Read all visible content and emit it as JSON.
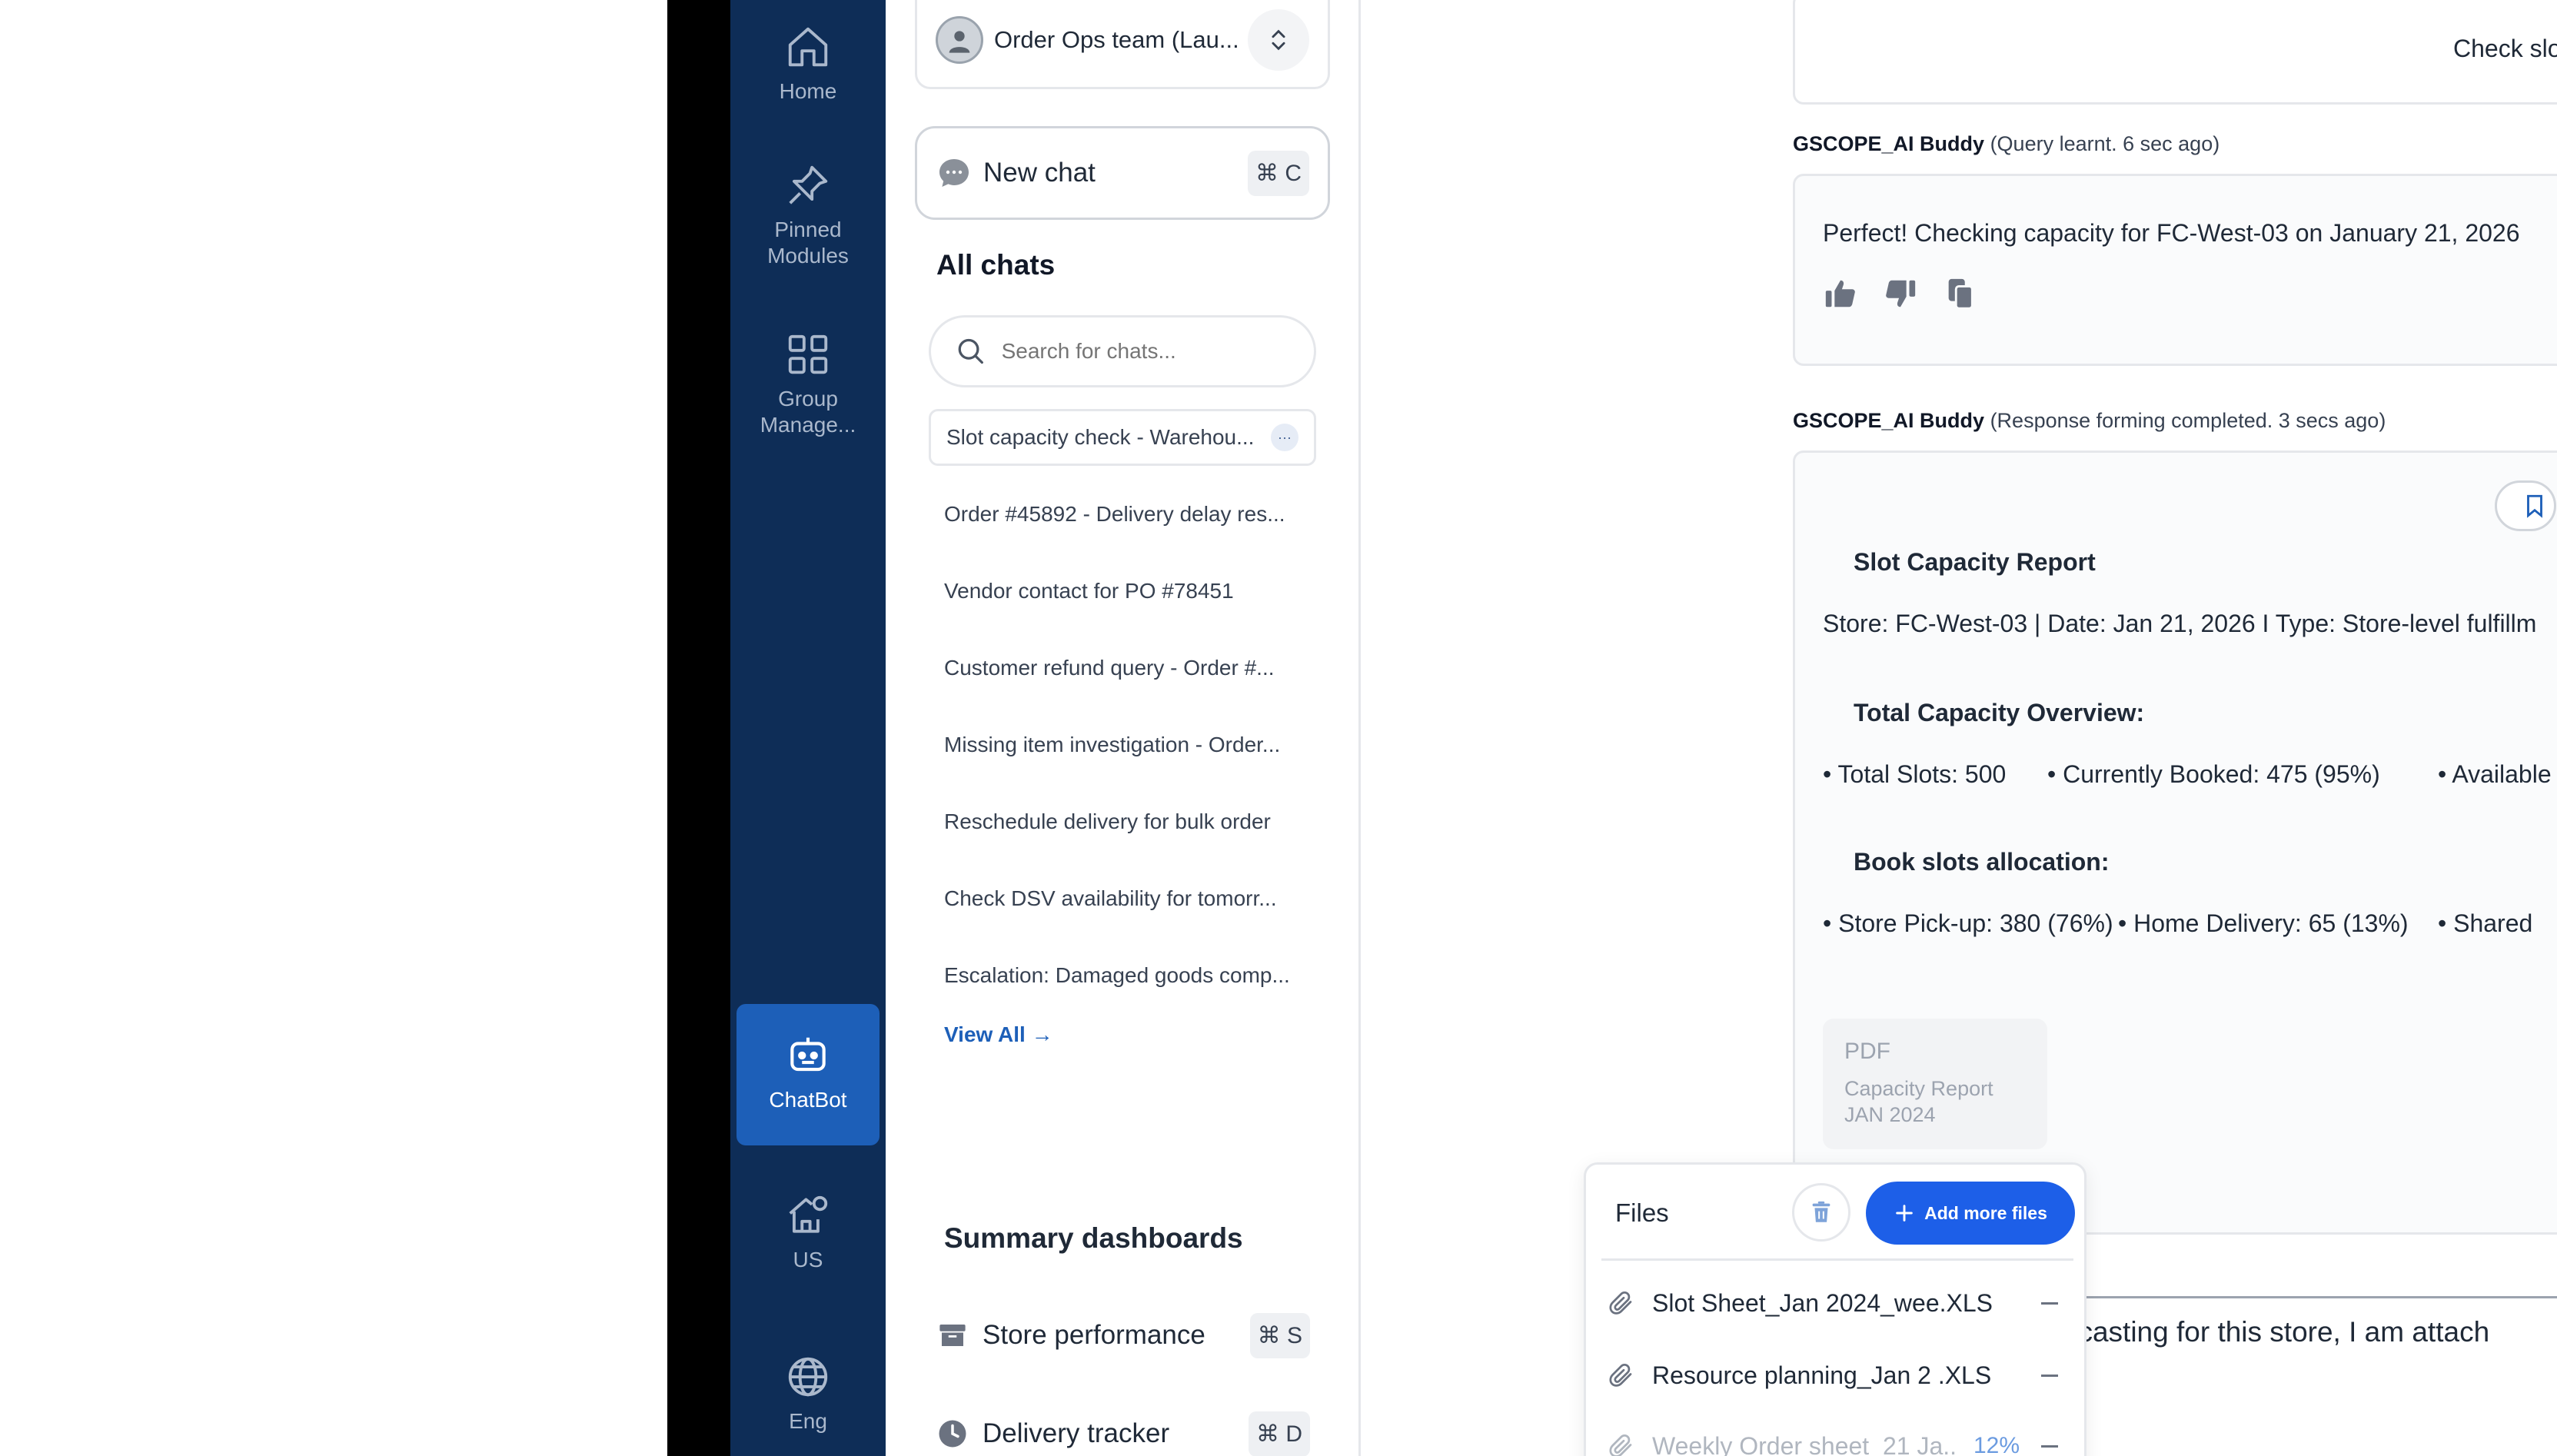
{
  "nav": {
    "home": "Home",
    "pinned": "Pinned\nModules",
    "group": "Group\nManage...",
    "chatbot": "ChatBot",
    "us": "US",
    "eng": "Eng"
  },
  "panel": {
    "team_name": "Order Ops team (Lau...",
    "new_chat": "New chat",
    "new_chat_shortcut": "⌘ C",
    "all_chats": "All chats",
    "search_placeholder": "Search for chats...",
    "chats": [
      "Slot capacity check - Warehou...",
      "Order #45892 - Delivery delay res...",
      "Vendor contact for PO #78451",
      "Customer refund query - Order #...",
      "Missing item investigation - Order...",
      "Reschedule delivery for bulk order",
      "Check DSV availability for tomorr...",
      "Escalation: Damaged goods comp..."
    ],
    "view_all": "View All →",
    "summary_title": "Summary dashboards",
    "dashboards": [
      {
        "label": "Store performance",
        "shortcut": "⌘ S"
      },
      {
        "label": "Delivery tracker",
        "shortcut": "⌘ D"
      }
    ]
  },
  "conversation": {
    "user_msg_1": "Check slo",
    "bot_name": "GSCOPE_AI Buddy",
    "meta_1": "(Query learnt. 6 sec ago)",
    "bot_msg_1": "Perfect! Checking capacity for FC-West-03 on January 21, 2026",
    "meta_2": "(Response forming completed. 3 secs ago)",
    "report_title": "Slot Capacity Report",
    "report_store_line": "Store: FC-West-03 | Date: Jan 21, 2026 I Type: Store-level fulfillm",
    "overview_title": "Total Capacity Overview:",
    "overview_items": [
      "• Total Slots: 500",
      "• Currently Booked: 475 (95%)",
      "• Available"
    ],
    "allocation_title": "Book slots allocation:",
    "allocation_items": [
      "• Store Pick-up: 380 (76%)",
      "• Home Delivery: 65 (13%)",
      "• Shared"
    ],
    "pdf_type": "PDF",
    "pdf_name_1": "Capacity Report",
    "pdf_name_2": "JAN 2024",
    "input_text": "precasting for this store, I am attach"
  },
  "files": {
    "title": "Files",
    "add_more": "Add more files",
    "items": [
      {
        "name": "Slot Sheet_Jan 2024_wee.XLS",
        "progress": ""
      },
      {
        "name": "Resource planning_Jan 2 .XLS",
        "progress": ""
      },
      {
        "name": "Weekly Order sheet_21 Ja..",
        "progress": "12%"
      }
    ]
  },
  "colors": {
    "nav_bg": "#0e2d57",
    "nav_active": "#1d5fb8",
    "accent": "#1d5fe8",
    "link": "#1d5fb8"
  }
}
